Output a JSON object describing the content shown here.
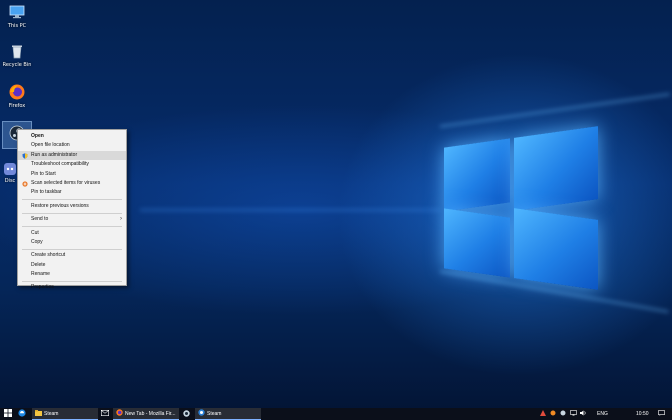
{
  "desktop": {
    "icons": [
      {
        "label": "This PC",
        "icon": "computer-icon"
      },
      {
        "label": "Recycle Bin",
        "icon": "recycle-bin-icon"
      },
      {
        "label": "Firefox",
        "icon": "firefox-icon"
      },
      {
        "label": "",
        "icon": "steam-icon"
      },
      {
        "label": "Disc",
        "icon": "discord-icon"
      }
    ]
  },
  "context_menu": {
    "items": [
      {
        "label": "Open"
      },
      {
        "label": "Open file location"
      },
      {
        "label": "Run as administrator",
        "icon": "shield-icon"
      },
      {
        "label": "Troubleshoot compatibility"
      },
      {
        "label": "Pin to Start"
      },
      {
        "label": "Scan selected items for viruses",
        "icon": "antivirus-icon"
      },
      {
        "label": "Pin to taskbar"
      },
      {
        "label": "Restore previous versions"
      },
      {
        "label": "Send to"
      },
      {
        "label": "Cut"
      },
      {
        "label": "Copy"
      },
      {
        "label": "Create shortcut"
      },
      {
        "label": "Delete"
      },
      {
        "label": "Rename"
      },
      {
        "label": "Properties"
      }
    ]
  },
  "taskbar": {
    "apps": [
      {
        "label": "Steam",
        "icon": "folder-icon"
      },
      {
        "label": "",
        "icon": "mail-icon"
      },
      {
        "label": "New Tab - Mozilla Fir...",
        "icon": "firefox-icon"
      },
      {
        "label": "",
        "icon": "steam-icon"
      },
      {
        "label": "Steam",
        "icon": "steam-icon"
      }
    ],
    "tray": {
      "language": "ENG",
      "time": "10:50"
    }
  },
  "colors": {
    "accent": "#1f7fe6",
    "taskbar": "#0b0f1a",
    "menu_bg": "#f2f2f2",
    "menu_hover": "#d9d9d9"
  }
}
